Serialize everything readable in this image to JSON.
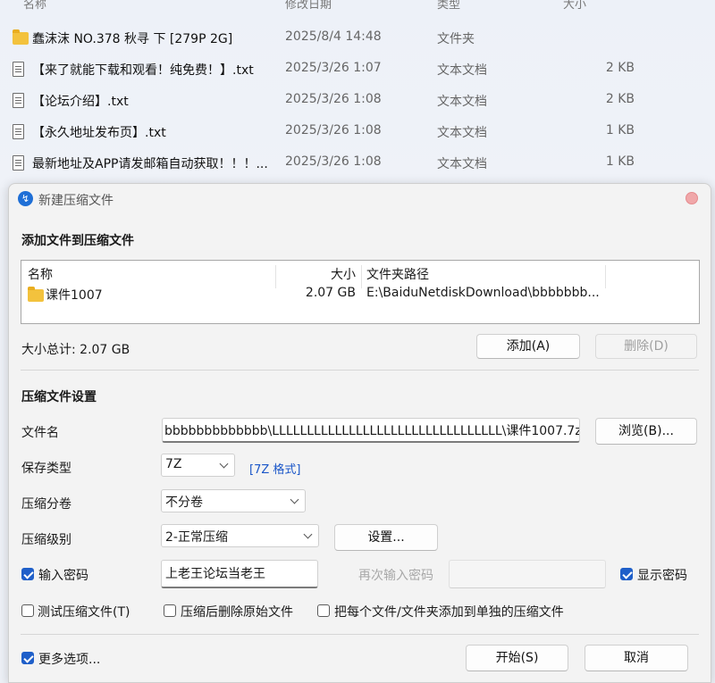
{
  "explorer": {
    "columns": {
      "name": "名称",
      "date": "修改日期",
      "type": "类型",
      "size": "大小"
    },
    "rows": [
      {
        "icon": "folder-icon",
        "name": "蠢沫沫 NO.378 秋寻 下 [279P 2G]",
        "date": "2025/8/4 14:48",
        "type": "文件夹",
        "size": ""
      },
      {
        "icon": "text-file-icon",
        "name": "【来了就能下载和观看！纯免费！】.txt",
        "date": "2025/3/26 1:07",
        "type": "文本文档",
        "size": "2 KB"
      },
      {
        "icon": "text-file-icon",
        "name": "【论坛介绍】.txt",
        "date": "2025/3/26 1:08",
        "type": "文本文档",
        "size": "2 KB"
      },
      {
        "icon": "text-file-icon",
        "name": "【永久地址发布页】.txt",
        "date": "2025/3/26 1:08",
        "type": "文本文档",
        "size": "1 KB"
      },
      {
        "icon": "text-file-icon",
        "name": "最新地址及APP请发邮箱自动获取！！！...",
        "date": "2025/3/26 1:08",
        "type": "文本文档",
        "size": "1 KB"
      }
    ]
  },
  "dialog": {
    "title": "新建压缩文件",
    "add_section_title": "添加文件到压缩文件",
    "list": {
      "headers": {
        "name": "名称",
        "size": "大小",
        "path": "文件夹路径"
      },
      "rows": [
        {
          "name": "课件1007",
          "size": "2.07 GB",
          "path": "E:\\BaiduNetdiskDownload\\bbbbbbb..."
        }
      ]
    },
    "total_label": "大小总计: 2.07 GB",
    "add_button": "添加(A)",
    "delete_button": "删除(D)",
    "settings_section_title": "压缩文件设置",
    "filename_label": "文件名",
    "filename_value": "bbbbbbbbbbbbb\\LLLLLLLLLLLLLLLLLLLLLLLLLLLLLLLLL\\课件1007.7z",
    "browse_button": "浏览(B)...",
    "save_type_label": "保存类型",
    "save_type_value": "7Z",
    "format_link": "[7Z 格式]",
    "split_label": "压缩分卷",
    "split_value": "不分卷",
    "level_label": "压缩级别",
    "level_value": "2-正常压缩",
    "settings_button": "设置...",
    "password_checkbox": "输入密码",
    "password_value": "上老王论坛当老王",
    "reenter_password_label": "再次输入密码",
    "show_password_checkbox": "显示密码",
    "test_checkbox": "测试压缩文件(T)",
    "delete_after_checkbox": "压缩后删除原始文件",
    "separate_checkbox": "把每个文件/文件夹添加到单独的压缩文件",
    "more_options_checkbox": "更多选项...",
    "start_button": "开始(S)",
    "cancel_button": "取消",
    "app_icon": "lightning-icon",
    "colors": {
      "accent": "#1f5fc9",
      "link": "#1a56c8",
      "close": "#f0a7a9"
    }
  }
}
